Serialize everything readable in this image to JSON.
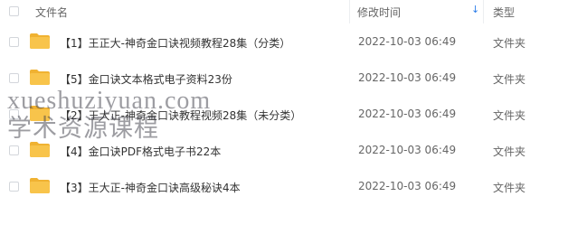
{
  "header": {
    "name": "文件名",
    "modified": "修改时间",
    "type": "类型"
  },
  "files": [
    {
      "name": "【1】王正大-神奇金口诀视频教程28集（分类）",
      "modified": "2022-10-03 06:49",
      "type": "文件夹",
      "icon": "folder-icon"
    },
    {
      "name": "【5】金口诀文本格式电子资料23份",
      "modified": "2022-10-03 06:49",
      "type": "文件夹",
      "icon": "folder-icon"
    },
    {
      "name": "【2】王大正-神奇金口诀教程视频28集（未分类）",
      "modified": "2022-10-03 06:49",
      "type": "文件夹",
      "icon": "folder-icon"
    },
    {
      "name": "【4】金口诀PDF格式电子书22本",
      "modified": "2022-10-03 06:49",
      "type": "文件夹",
      "icon": "folder-icon"
    },
    {
      "name": "【3】王大正-神奇金口诀高级秘诀4本",
      "modified": "2022-10-03 06:49",
      "type": "文件夹",
      "icon": "folder-icon"
    }
  ],
  "watermark": {
    "line1": "xueshuziyuan.com",
    "line2": "学术资源课程"
  },
  "colors": {
    "folder": "#f8c44b",
    "folder_tab": "#f0b232",
    "sort_arrow": "#2b7de9"
  }
}
